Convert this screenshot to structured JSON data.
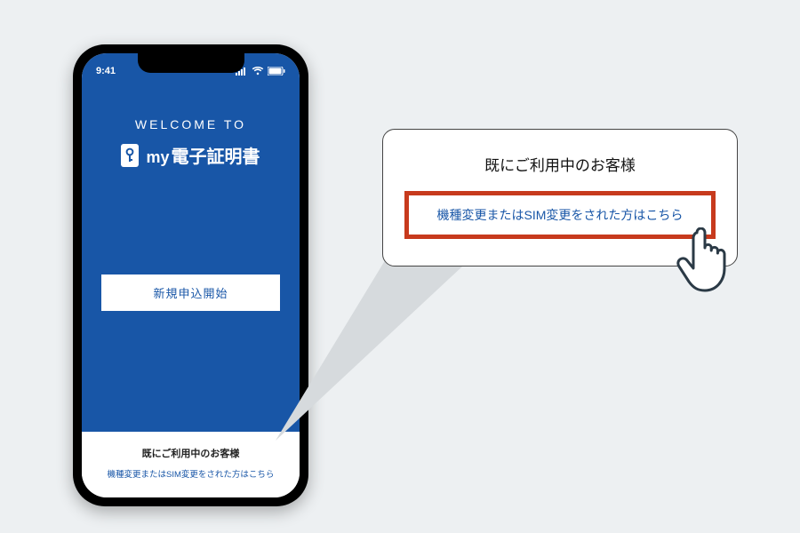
{
  "statusbar": {
    "time": "9:41"
  },
  "welcome_label": "WELCOME TO",
  "logo": {
    "my": "my",
    "title": "電子証明書"
  },
  "start_button": "新規申込開始",
  "existing": {
    "title": "既にご利用中のお客様",
    "link": "機種変更またはSIM変更をされた方はこちら"
  },
  "callout": {
    "title": "既にご利用中のお客様",
    "link": "機種変更またはSIM変更をされた方はこちら"
  },
  "colors": {
    "brand_blue": "#1856a7",
    "highlight_red": "#c73a1d",
    "page_bg": "#edf0f2"
  }
}
